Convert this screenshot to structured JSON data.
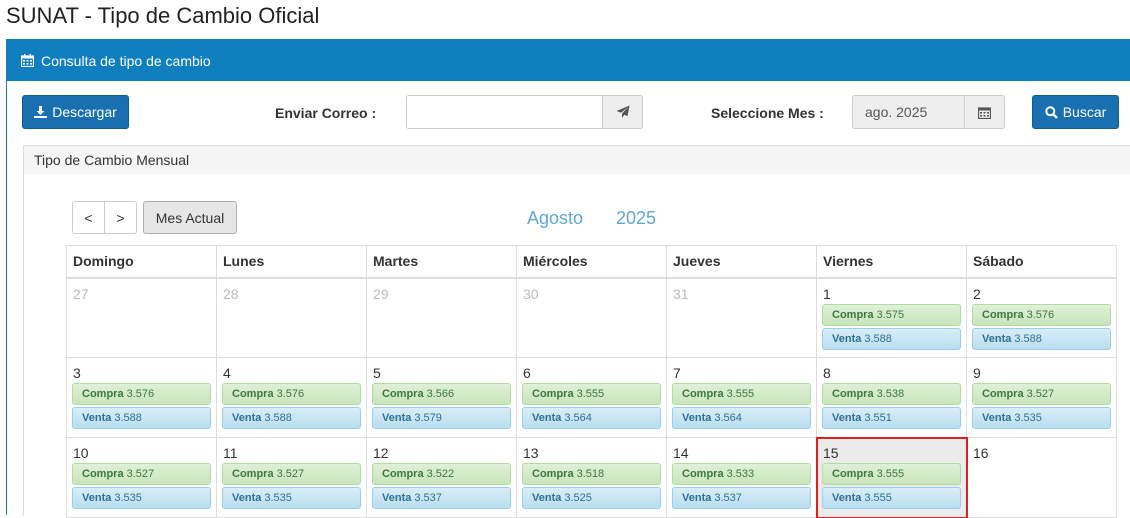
{
  "page_title": "SUNAT - Tipo de Cambio Oficial",
  "panel_title": "Consulta de tipo de cambio",
  "toolbar": {
    "download_label": "Descargar",
    "email_label": "Enviar Correo :",
    "email_value": "",
    "month_label": "Seleccione Mes :",
    "month_value": "ago. 2025",
    "search_label": "Buscar"
  },
  "sub_panel_title": "Tipo de Cambio Mensual",
  "calendar": {
    "prev": "<",
    "next": ">",
    "current_month_button": "Mes Actual",
    "month": "Agosto",
    "year": "2025",
    "weekdays": [
      "Domingo",
      "Lunes",
      "Martes",
      "Miércoles",
      "Jueves",
      "Viernes",
      "Sábado"
    ],
    "weeks": [
      [
        {
          "day": "27",
          "other": true
        },
        {
          "day": "28",
          "other": true
        },
        {
          "day": "29",
          "other": true
        },
        {
          "day": "30",
          "other": true
        },
        {
          "day": "31",
          "other": true
        },
        {
          "day": "1",
          "compra": "3.575",
          "venta": "3.588"
        },
        {
          "day": "2",
          "compra": "3.576",
          "venta": "3.588"
        }
      ],
      [
        {
          "day": "3",
          "compra": "3.576",
          "venta": "3.588"
        },
        {
          "day": "4",
          "compra": "3.576",
          "venta": "3.588"
        },
        {
          "day": "5",
          "compra": "3.566",
          "venta": "3.579"
        },
        {
          "day": "6",
          "compra": "3.555",
          "venta": "3.564"
        },
        {
          "day": "7",
          "compra": "3.555",
          "venta": "3.564"
        },
        {
          "day": "8",
          "compra": "3.538",
          "venta": "3.551"
        },
        {
          "day": "9",
          "compra": "3.527",
          "venta": "3.535"
        }
      ],
      [
        {
          "day": "10",
          "compra": "3.527",
          "venta": "3.535"
        },
        {
          "day": "11",
          "compra": "3.527",
          "venta": "3.535"
        },
        {
          "day": "12",
          "compra": "3.522",
          "venta": "3.537"
        },
        {
          "day": "13",
          "compra": "3.518",
          "venta": "3.525"
        },
        {
          "day": "14",
          "compra": "3.533",
          "venta": "3.537"
        },
        {
          "day": "15",
          "compra": "3.555",
          "venta": "3.555",
          "today": true
        },
        {
          "day": "16"
        }
      ]
    ],
    "compra_label": "Compra",
    "venta_label": "Venta"
  },
  "colors": {
    "header_blue": "#0f7fc0",
    "button_blue": "#1a6fb0",
    "today_outline": "#e02020",
    "title_blue": "#5fa8d3"
  }
}
